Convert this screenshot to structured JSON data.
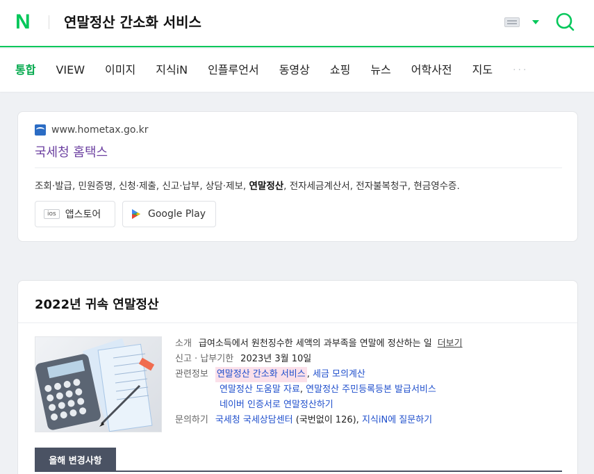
{
  "header": {
    "logo": "N",
    "query": "연말정산 간소화 서비스"
  },
  "nav": {
    "tabs": [
      "통합",
      "VIEW",
      "이미지",
      "지식iN",
      "인플루언서",
      "동영상",
      "쇼핑",
      "뉴스",
      "어학사전",
      "지도"
    ],
    "more": "···"
  },
  "result1": {
    "url": "www.hometax.go.kr",
    "title": "국세청 홈택스",
    "desc_before": "조회·발급, 민원증명, 신청·제출, 신고·납부, 상담·제보, ",
    "desc_bold": "연말정산",
    "desc_after": ", 전자세금계산서, 전자불복청구, 현금영수증.",
    "ios_badge": "ios",
    "appstore_label": "앱스토어",
    "gplay_label": "Google Play"
  },
  "result2": {
    "title": "2022년 귀속 연말정산",
    "intro_label": "소개",
    "intro_text": "급여소득에서 원천징수한 세액의 과부족을 연말에 정산하는 일",
    "more_link": "더보기",
    "deadline_label": "신고 · 납부기한",
    "deadline_value": "2023년 3월 10일",
    "related_label": "관련정보",
    "related_links": [
      "연말정산 간소화 서비스",
      "세금 모의계산",
      "연말정산 도움말 자료",
      "연말정산 주민등록등본 발급서비스",
      "네이버 인증서로 연말정산하기"
    ],
    "contact_label": "문의하기",
    "contact_link1": "국세청 국세상담센터",
    "contact_text": " (국번없이 126), ",
    "contact_link2": "지식iN에 질문하기",
    "tab_label": "올해 변경사항"
  }
}
